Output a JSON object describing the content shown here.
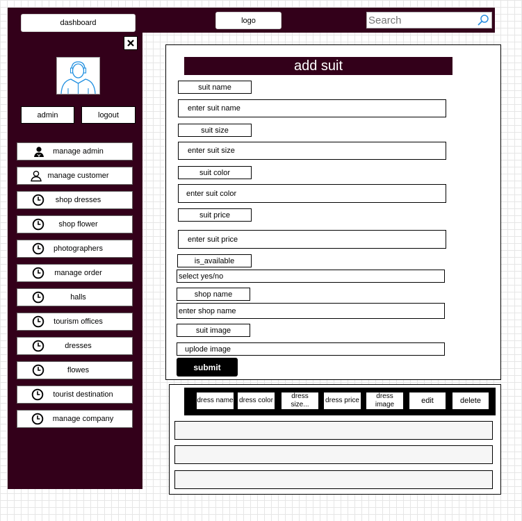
{
  "header": {
    "dashboard_label": "dashboard",
    "logo_label": "logo",
    "search_placeholder": "Search"
  },
  "sidebar": {
    "admin_label": "admin",
    "logout_label": "logout",
    "items": [
      {
        "label": "manage admin",
        "icon": "user-icon"
      },
      {
        "label": "manage customer",
        "icon": "user-icon"
      },
      {
        "label": "shop dresses",
        "icon": "clock-icon"
      },
      {
        "label": "shop flower",
        "icon": "clock-icon"
      },
      {
        "label": "photographers",
        "icon": "clock-icon"
      },
      {
        "label": "manage order",
        "icon": "clock-icon"
      },
      {
        "label": "halls",
        "icon": "clock-icon"
      },
      {
        "label": "tourism offices",
        "icon": "clock-icon"
      },
      {
        "label": "dresses",
        "icon": "clock-icon"
      },
      {
        "label": "flowes",
        "icon": "clock-icon"
      },
      {
        "label": "tourist destination",
        "icon": "clock-icon"
      },
      {
        "label": "manage company",
        "icon": "clock-icon"
      }
    ]
  },
  "form": {
    "title": "add suit",
    "fields": [
      {
        "label": "suit name",
        "placeholder": "enter suit name"
      },
      {
        "label": "suit size",
        "placeholder": "enter suit size"
      },
      {
        "label": "suit color",
        "placeholder": "enter suit color"
      },
      {
        "label": "suit price",
        "placeholder": "enter suit price"
      },
      {
        "label": "is_available",
        "placeholder": "select yes/no"
      },
      {
        "label": "shop name",
        "placeholder": "enter shop name"
      },
      {
        "label": "suit image",
        "placeholder": "uplode image"
      }
    ],
    "submit_label": "submit"
  },
  "table": {
    "columns": [
      "dress name",
      "dress color",
      "dress size...",
      "dress price",
      "dress image",
      "edit",
      "delete"
    ]
  },
  "colors": {
    "sidebar_bg": "#33001a",
    "accent": "#33001a"
  }
}
